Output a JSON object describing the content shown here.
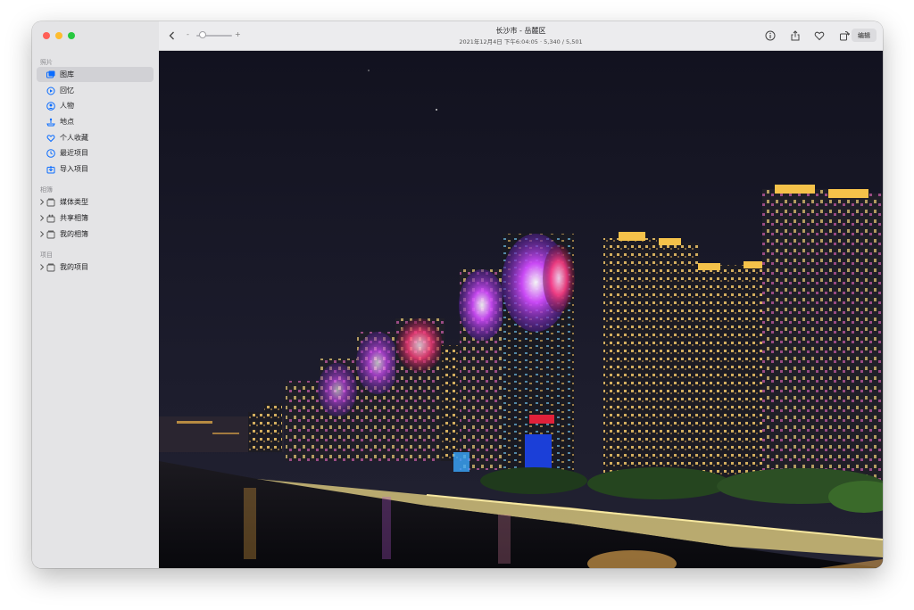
{
  "sidebar": {
    "section_photos": "照片",
    "items_photos": [
      {
        "label": "图库",
        "icon": "library-icon",
        "active": true
      },
      {
        "label": "回忆",
        "icon": "memories-icon"
      },
      {
        "label": "人物",
        "icon": "people-icon"
      },
      {
        "label": "地点",
        "icon": "places-icon"
      },
      {
        "label": "个人收藏",
        "icon": "favorites-icon"
      },
      {
        "label": "最近项目",
        "icon": "recents-icon"
      },
      {
        "label": "导入项目",
        "icon": "imports-icon"
      }
    ],
    "section_albums": "相簿",
    "items_albums": [
      {
        "label": "媒体类型",
        "icon": "folder-icon"
      },
      {
        "label": "共享相簿",
        "icon": "shared-folder-icon"
      },
      {
        "label": "我的相簿",
        "icon": "folder-icon"
      }
    ],
    "section_projects": "项目",
    "items_projects": [
      {
        "label": "我的项目",
        "icon": "folder-icon"
      }
    ]
  },
  "toolbar": {
    "title": "长沙市 - 岳麓区",
    "subtitle": "2021年12月4日 下午6:04:05 · 5,340 / 5,501",
    "zoom_minus": "-",
    "zoom_plus": "+",
    "zoom_level": 0.15,
    "edit_label": "编辑"
  },
  "photo": {
    "description_icon": "photo-image"
  },
  "colors": {
    "accent": "#0a6cff",
    "sidebar_bg": "#e4e4e6",
    "toolbar_bg": "#ececee"
  }
}
